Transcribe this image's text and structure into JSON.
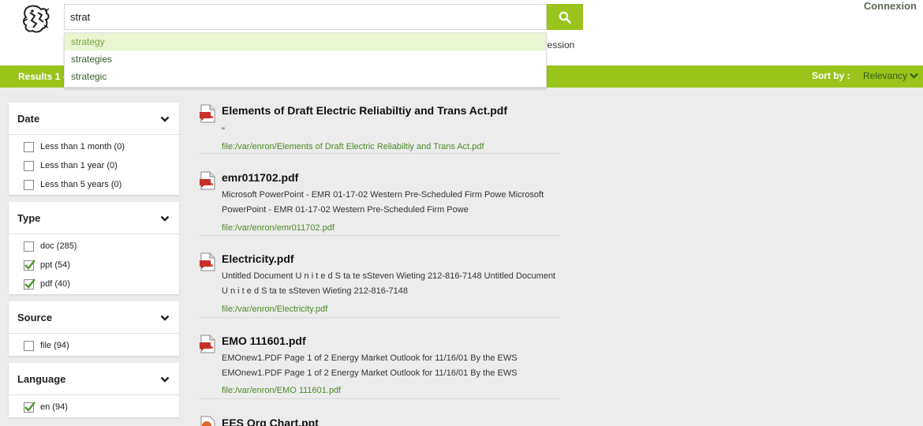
{
  "header": {
    "search_value": "strat",
    "connexion_label": "Connexion",
    "partial_label": "pression"
  },
  "suggestions": [
    "strategy",
    "strategies",
    "strategic"
  ],
  "resultsbar": {
    "count_label": "Results 1 -",
    "sort_label": "Sort by :",
    "sort_value": "Relevancy"
  },
  "facets": [
    {
      "title": "Date",
      "options": [
        {
          "label": "Less than 1 month (0)",
          "checked": false
        },
        {
          "label": "Less than 1 year (0)",
          "checked": false
        },
        {
          "label": "Less than 5 years (0)",
          "checked": false
        }
      ]
    },
    {
      "title": "Type",
      "options": [
        {
          "label": "doc (285)",
          "checked": false
        },
        {
          "label": "ppt (54)",
          "checked": true
        },
        {
          "label": "pdf (40)",
          "checked": true
        }
      ]
    },
    {
      "title": "Source",
      "options": [
        {
          "label": "file (94)",
          "checked": false
        }
      ]
    },
    {
      "title": "Language",
      "options": [
        {
          "label": "en (94)",
          "checked": true
        }
      ]
    }
  ],
  "results": [
    {
      "title": "Elements of Draft Electric Reliabiltiy and Trans Act.pdf",
      "snippet_lines": [
        "\""
      ],
      "path": "file:/var/enron/Elements of Draft Electric Reliabiltiy and Trans Act.pdf",
      "icon": "pdf-icon"
    },
    {
      "title": "emr011702.pdf",
      "snippet_lines": [
        "Microsoft PowerPoint - EMR 01-17-02 Western Pre-Scheduled Firm Powe Microsoft",
        "PowerPoint - EMR 01-17-02 Western Pre-Scheduled Firm Powe"
      ],
      "path": "file:/var/enron/emr011702.pdf",
      "icon": "pdf-icon"
    },
    {
      "title": "Electricity.pdf",
      "snippet_lines": [
        "Untitled Document U n i t e d S ta te sSteven Wieting 212-816-7148 Untitled Document",
        "U n i t e d S ta te sSteven Wieting 212-816-7148"
      ],
      "path": "file:/var/enron/Electricity.pdf",
      "icon": "pdf-icon"
    },
    {
      "title": "EMO 111601.pdf",
      "snippet_lines": [
        "EMOnew1.PDF Page 1 of 2 Energy Market Outlook for 11/16/01 By the EWS",
        "EMOnew1.PDF Page 1 of 2 Energy Market Outlook for 11/16/01 By the EWS"
      ],
      "path": "file:/var/enron/EMO 111601.pdf",
      "icon": "pdf-icon"
    },
    {
      "title": "EES Org Chart.ppt",
      "snippet_lines": [],
      "path": "",
      "icon": "ppt-icon"
    }
  ],
  "colors": {
    "accent": "#9ac31c",
    "path": "#4f8a2a",
    "sort_value": "#2f5a12"
  }
}
